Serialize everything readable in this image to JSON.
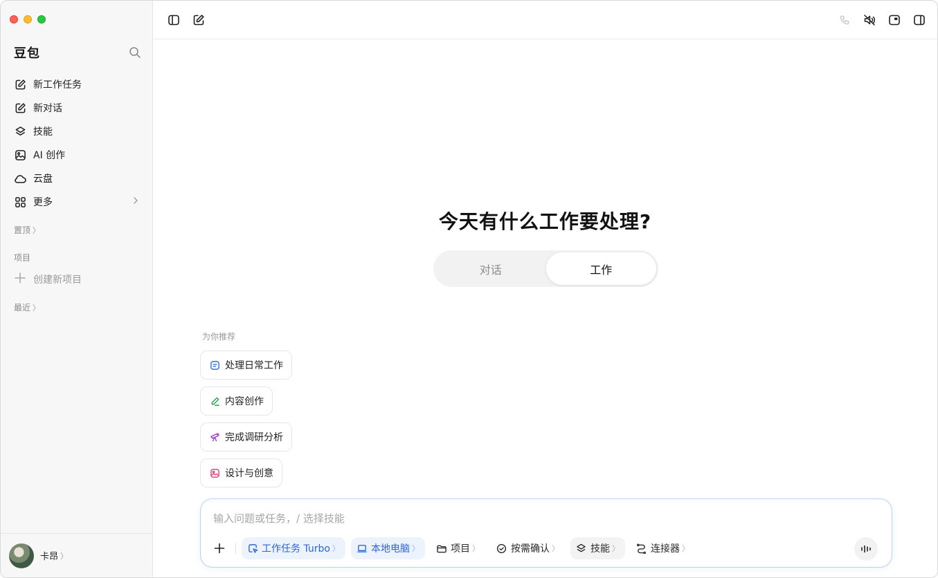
{
  "app": {
    "title": "豆包"
  },
  "sidebar": {
    "items": [
      {
        "label": "新工作任务",
        "icon": "edit-icon"
      },
      {
        "label": "新对话",
        "icon": "edit-icon"
      },
      {
        "label": "技能",
        "icon": "layers-icon"
      },
      {
        "label": "AI 创作",
        "icon": "image-icon"
      },
      {
        "label": "云盘",
        "icon": "cloud-icon"
      },
      {
        "label": "更多",
        "icon": "grid-icon"
      }
    ],
    "pinned_label": "置顶",
    "projects_label": "项目",
    "create_project_label": "创建新项目",
    "recent_label": "最近",
    "user_name": "卡昂",
    "chevron": "〉"
  },
  "main": {
    "headline": "今天有什么工作要处理?",
    "mode_switch": {
      "options": [
        "对话",
        "工作"
      ],
      "active": "工作"
    },
    "recommend_label": "为你推荐",
    "recommendations": [
      {
        "label": "处理日常工作",
        "icon": "task-icon",
        "color": "#2f6fe0"
      },
      {
        "label": "内容创作",
        "icon": "pen-icon",
        "color": "#27a34a"
      },
      {
        "label": "完成调研分析",
        "icon": "telescope-icon",
        "color": "#a23ad6"
      },
      {
        "label": "设计与创意",
        "icon": "image-icon",
        "color": "#e0457b"
      }
    ],
    "composer": {
      "placeholder": "输入问题或任务，/ 选择技能",
      "pills": [
        {
          "label": "工作任务 Turbo",
          "icon": "cursor-icon"
        },
        {
          "label": "本地电脑",
          "icon": "laptop-icon"
        },
        {
          "label": "项目",
          "icon": "folder-icon"
        },
        {
          "label": "按需确认",
          "icon": "shield-check-icon"
        },
        {
          "label": "技能",
          "icon": "layers-icon"
        },
        {
          "label": "连接器",
          "icon": "connector-icon"
        }
      ],
      "chevron": "〉"
    }
  },
  "colors": {
    "accent": "#2a66d9",
    "composer_border": "#b9d0f3"
  }
}
